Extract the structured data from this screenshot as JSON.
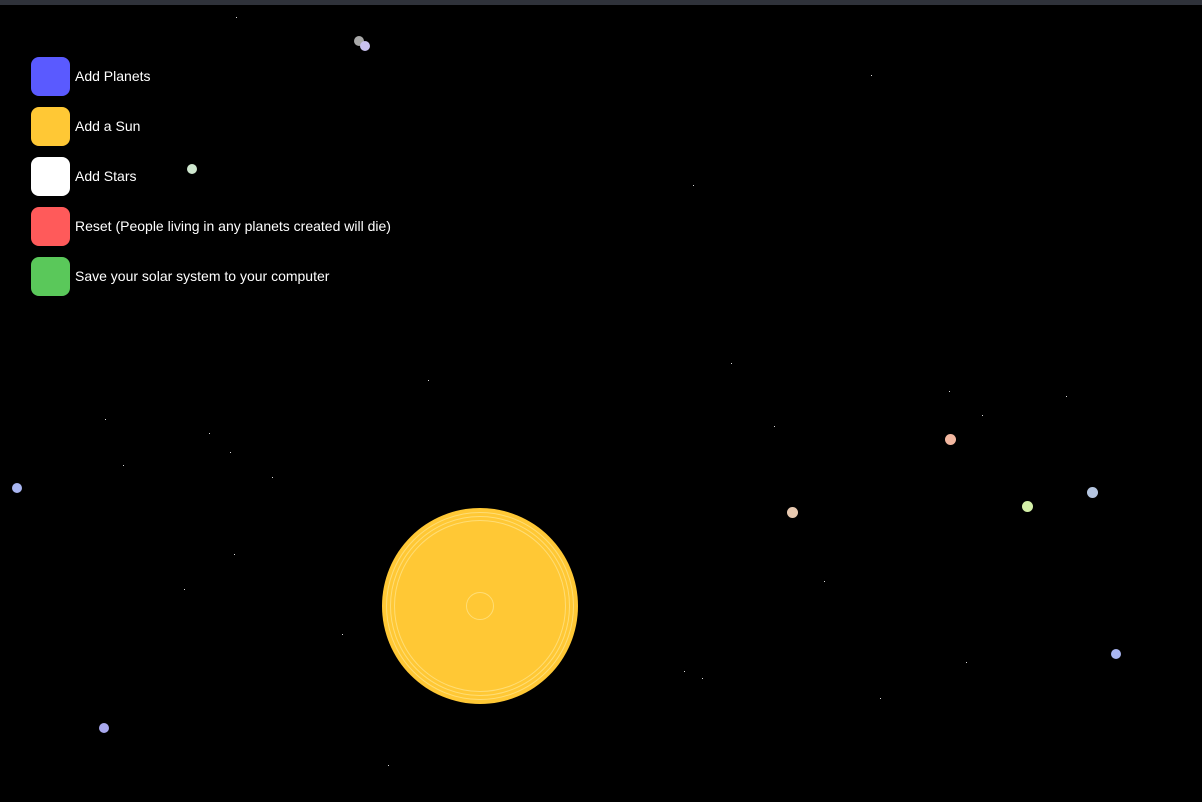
{
  "menu": {
    "items": [
      {
        "label": "Add Planets",
        "color": "#5a5aff",
        "icon": "add-planets-icon"
      },
      {
        "label": "Add a Sun",
        "color": "#ffc835",
        "icon": "add-sun-icon"
      },
      {
        "label": "Add Stars",
        "color": "#ffffff",
        "icon": "add-stars-icon"
      },
      {
        "label": "Reset (People living in any planets created will die)",
        "color": "#ff5a5a",
        "icon": "reset-icon"
      },
      {
        "label": "Save your solar system to your computer",
        "color": "#5ac85a",
        "icon": "save-icon"
      }
    ]
  },
  "scene": {
    "background": "#000000",
    "sun_color": "#ffc835",
    "planet_colors": [
      "#a9a9a9",
      "#c9c2f0",
      "#cfe8cf",
      "#f2b7a0",
      "#e8c9b0",
      "#d4f0a8",
      "#b5c5e0",
      "#a9b6f2",
      "#a9a9ee",
      "#b0b7ff"
    ]
  }
}
